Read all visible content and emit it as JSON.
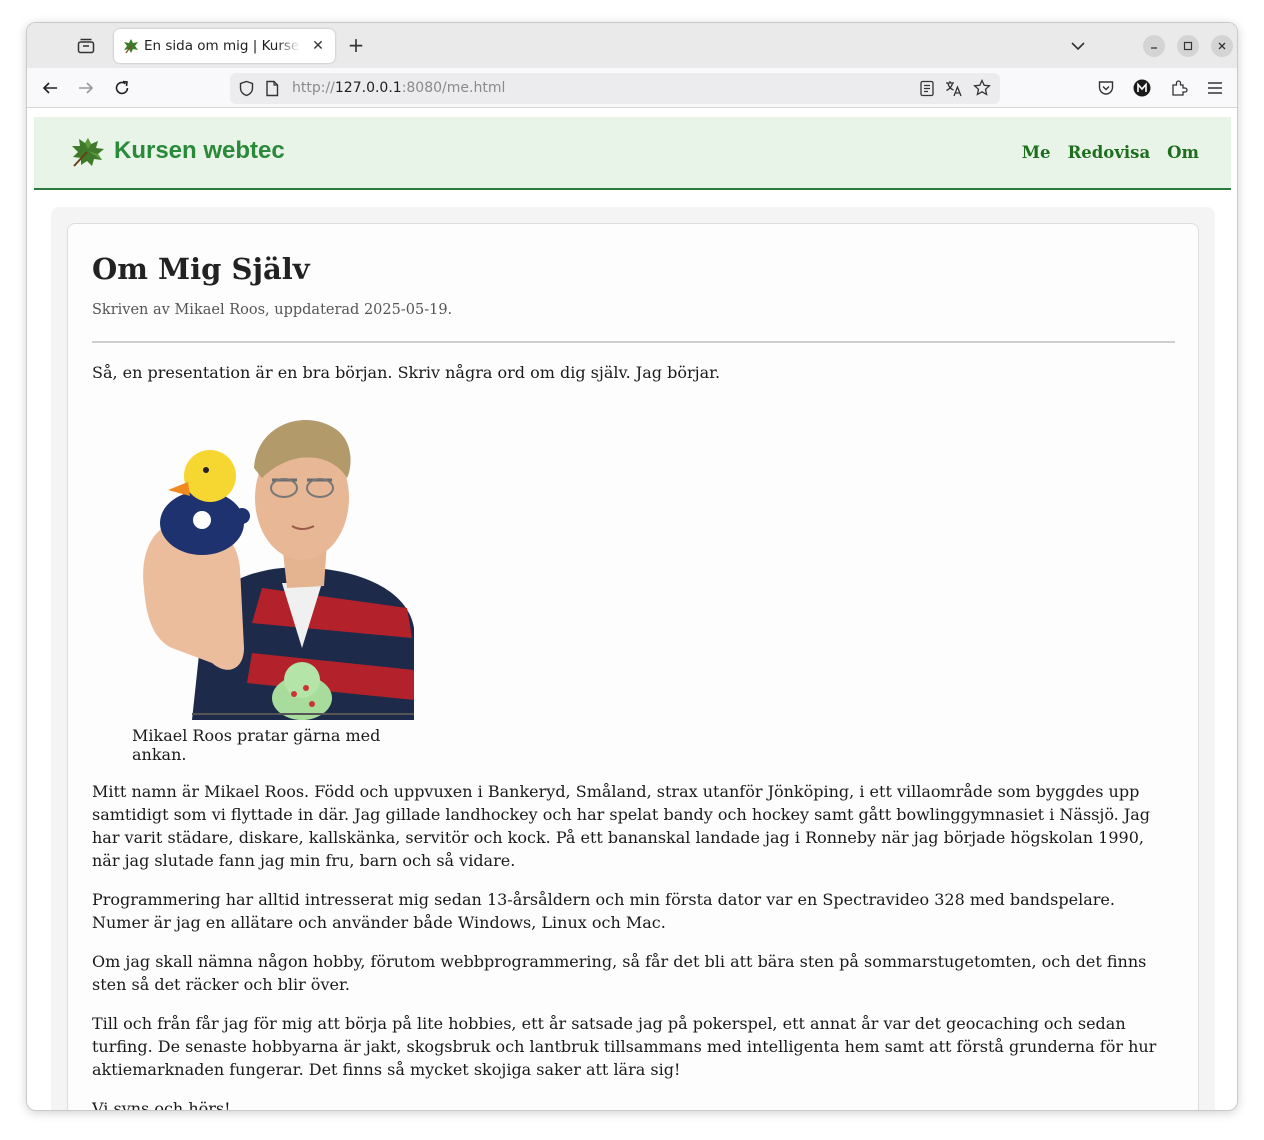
{
  "browser": {
    "tab": {
      "title": "En sida om mig | Kursen webtec",
      "close": "✕"
    },
    "new_tab": "+",
    "url": {
      "scheme": "http://",
      "host": "127.0.0.1",
      "rest": ":8080/me.html"
    }
  },
  "site": {
    "title": "Kursen webtec",
    "nav": [
      "Me",
      "Redovisa",
      "Om"
    ]
  },
  "article": {
    "title": "Om Mig Själv",
    "byline": "Skriven av Mikael Roos, uppdaterad 2025-05-19.",
    "intro": "Så, en presentation är en bra början. Skriv några ord om dig själv. Jag börjar.",
    "caption": "Mikael Roos pratar gärna med ankan.",
    "paragraphs": [
      "Mitt namn är Mikael Roos. Född och uppvuxen i Bankeryd, Småland, strax utanför Jönköping, i ett villaområde som byggdes upp samtidigt som vi flyttade in där. Jag gillade landhockey och har spelat bandy och hockey samt gått bowlinggymnasiet i Nässjö. Jag har varit städare, diskare, kallskänka, servitör och kock. På ett bananskal landade jag i Ronneby när jag började högskolan 1990, när jag slutade fann jag min fru, barn och så vidare.",
      "Programmering har alltid intresserat mig sedan 13-årsåldern och min första dator var en Spectravideo 328 med bandspelare. Numer är jag en allätare och använder både Windows, Linux och Mac.",
      "Om jag skall nämna någon hobby, förutom webbprogrammering, så får det bli att bära sten på sommarstugetomten, och det finns sten så det räcker och blir över.",
      "Till och från får jag för mig att börja på lite hobbies, ett år satsade jag på pokerspel, ett annat år var det geocaching och sedan turfing. De senaste hobbyarna är jakt, skogsbruk och lantbruk tillsammans med intelligenta hem samt att förstå grunderna för hur aktiemarknaden fungerar. Det finns så mycket skojiga saker att lära sig!",
      "Vi syns och hörs!"
    ]
  },
  "colors": {
    "header_bg": "#e8f4e8",
    "brand_green": "#2a8a3a",
    "nav_green": "#1e6e1e"
  }
}
